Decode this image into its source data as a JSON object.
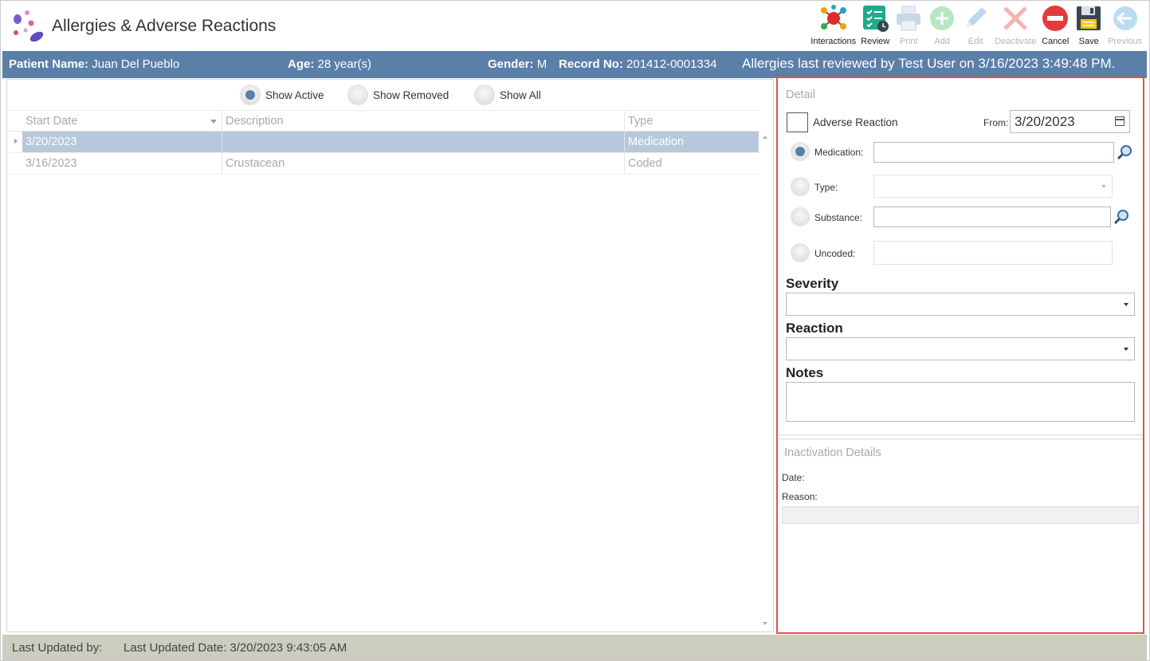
{
  "app": {
    "title": "Allergies & Adverse Reactions"
  },
  "toolbar": {
    "buttons": [
      {
        "label": "Interactions",
        "icon": "interactions-icon",
        "enabled": true
      },
      {
        "label": "Review",
        "icon": "review-checklist-icon",
        "enabled": true
      },
      {
        "label": "Print",
        "icon": "printer-icon",
        "enabled": false
      },
      {
        "label": "Add",
        "icon": "add-icon",
        "enabled": false
      },
      {
        "label": "Edit",
        "icon": "pencil-icon",
        "enabled": false
      },
      {
        "label": "Deactivate",
        "icon": "deactivate-x-icon",
        "enabled": false
      },
      {
        "label": "Cancel",
        "icon": "cancel-icon",
        "enabled": true
      },
      {
        "label": "Save",
        "icon": "save-icon",
        "enabled": true
      },
      {
        "label": "Previous",
        "icon": "previous-arrow-icon",
        "enabled": false
      }
    ]
  },
  "patient": {
    "name_label": "Patient Name:",
    "name": "Juan Del Pueblo",
    "age_label": "Age:",
    "age": "28 year(s)",
    "gender_label": "Gender:",
    "gender": "M",
    "record_label": "Record No:",
    "record": "201412-0001334",
    "reviewed": "Allergies last reviewed by Test User on 3/16/2023 3:49:48 PM."
  },
  "filters": {
    "show_active": "Show Active",
    "show_removed": "Show Removed",
    "show_all": "Show All",
    "selected": "show_active"
  },
  "grid": {
    "columns": [
      "Start Date",
      "Description",
      "Type"
    ],
    "rows": [
      {
        "start_date": "3/20/2023",
        "description": "",
        "type": "Medication",
        "selected": true
      },
      {
        "start_date": "3/16/2023",
        "description": "Crustacean",
        "type": "Coded",
        "selected": false
      }
    ]
  },
  "detail": {
    "title": "Detail",
    "adverse_reaction_label": "Adverse Reaction",
    "from_label": "From:",
    "from_value": "3/20/2023",
    "medication_label": "Medication:",
    "type_label": "Type:",
    "substance_label": "Substance:",
    "uncoded_label": "Uncoded:",
    "severity_label": "Severity",
    "reaction_label": "Reaction",
    "notes_label": "Notes"
  },
  "inactivation": {
    "title": "Inactivation Details",
    "date_label": "Date:",
    "reason_label": "Reason:"
  },
  "status": {
    "updated_by_label": "Last Updated by:",
    "updated_date": "Last Updated Date: 3/20/2023 9:43:05 AM"
  },
  "colors": {
    "accent": "#5a7fa8",
    "selection": "#b7c8dd",
    "highlight_border": "#e0534a",
    "statusbar": "#ccccbf"
  }
}
